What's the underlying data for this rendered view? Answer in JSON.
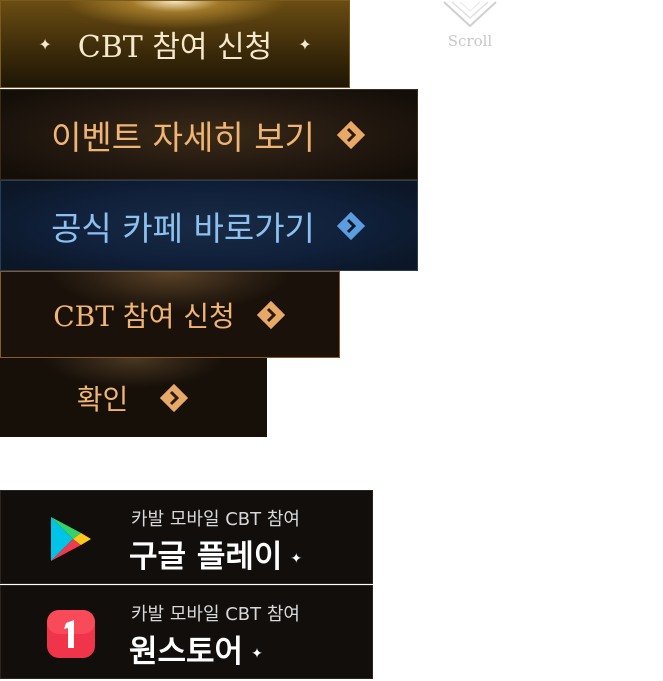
{
  "scroll": {
    "label": "Scroll"
  },
  "buttons": {
    "cbt_gold": {
      "label": "CBT 참여 신청",
      "spark": "✦"
    },
    "event_detail": {
      "label": "이벤트 자세히 보기"
    },
    "official_cafe": {
      "label": "공식 카페 바로가기"
    },
    "cbt_brown": {
      "label": "CBT 참여 신청"
    },
    "confirm": {
      "label": "확인"
    }
  },
  "stores": [
    {
      "sub": "카발 모바일 CBT 참여",
      "main": "구글 플레이",
      "icon": "google-play-icon",
      "star": "✦"
    },
    {
      "sub": "카발 모바일 CBT 참여",
      "main": "원스토어",
      "icon": "onestore-icon",
      "star": "✦"
    }
  ],
  "colors": {
    "gold_text": "#f5e8cc",
    "orange_text": "#f0b473",
    "blue_text": "#8cc0f0",
    "chevron_orange": "#e8a866",
    "chevron_blue": "#5a9ee0"
  }
}
